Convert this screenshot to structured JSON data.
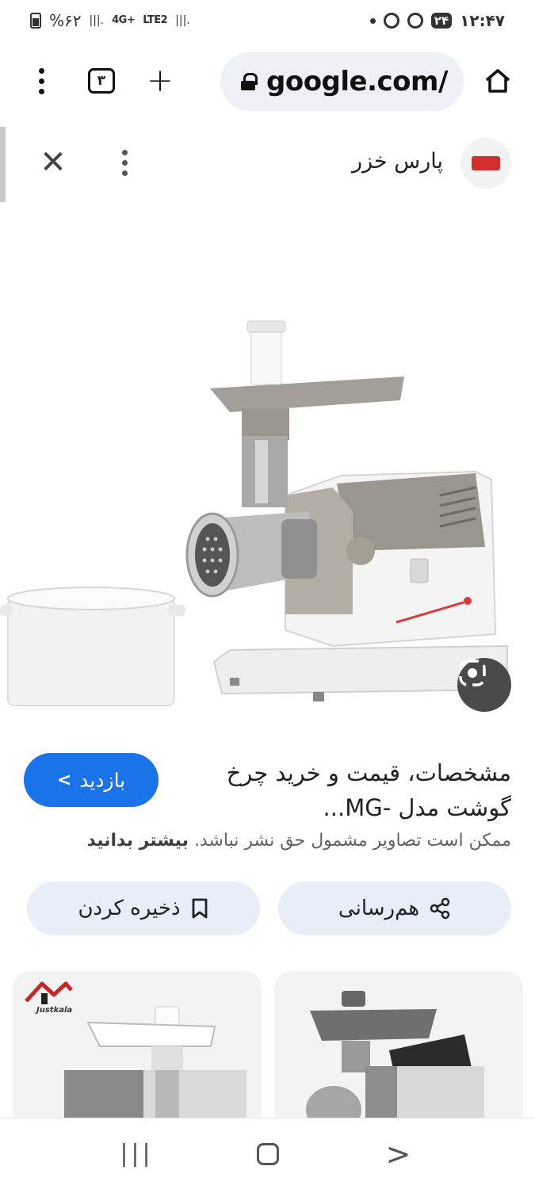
{
  "status_bar": {
    "battery": "%۶۲",
    "network_signal": "4G+",
    "network_lte": "LTE2",
    "notif_badge": "۲۴",
    "time": "۱۲:۴۷"
  },
  "browser": {
    "tab_count": "۳",
    "url": "google.com/",
    "icons": {
      "menu": "more-vert-icon",
      "new_tab": "plus-icon",
      "lock": "lock-icon",
      "home": "home-icon"
    }
  },
  "viewer": {
    "source_name": "پارس خزر",
    "close_glyph": "✕",
    "title": "مشخصات، قیمت و خرید چرخ گوشت مدل -MG...",
    "visit_label": "بازدید",
    "disclaimer_text": "ممکن است تصاویر مشمول حق نشر نباشد.",
    "learn_more": "بیشتر بدانید",
    "share_label": "هم‌رسانی",
    "save_label": "ذخیره کردن"
  },
  "thumbnails": [
    {
      "source": "Justkala"
    },
    {
      "source": ""
    }
  ],
  "colors": {
    "accent_blue": "#1a73e8",
    "chip_bg": "#e8eef8",
    "omnibox_bg": "#edf1f7"
  }
}
